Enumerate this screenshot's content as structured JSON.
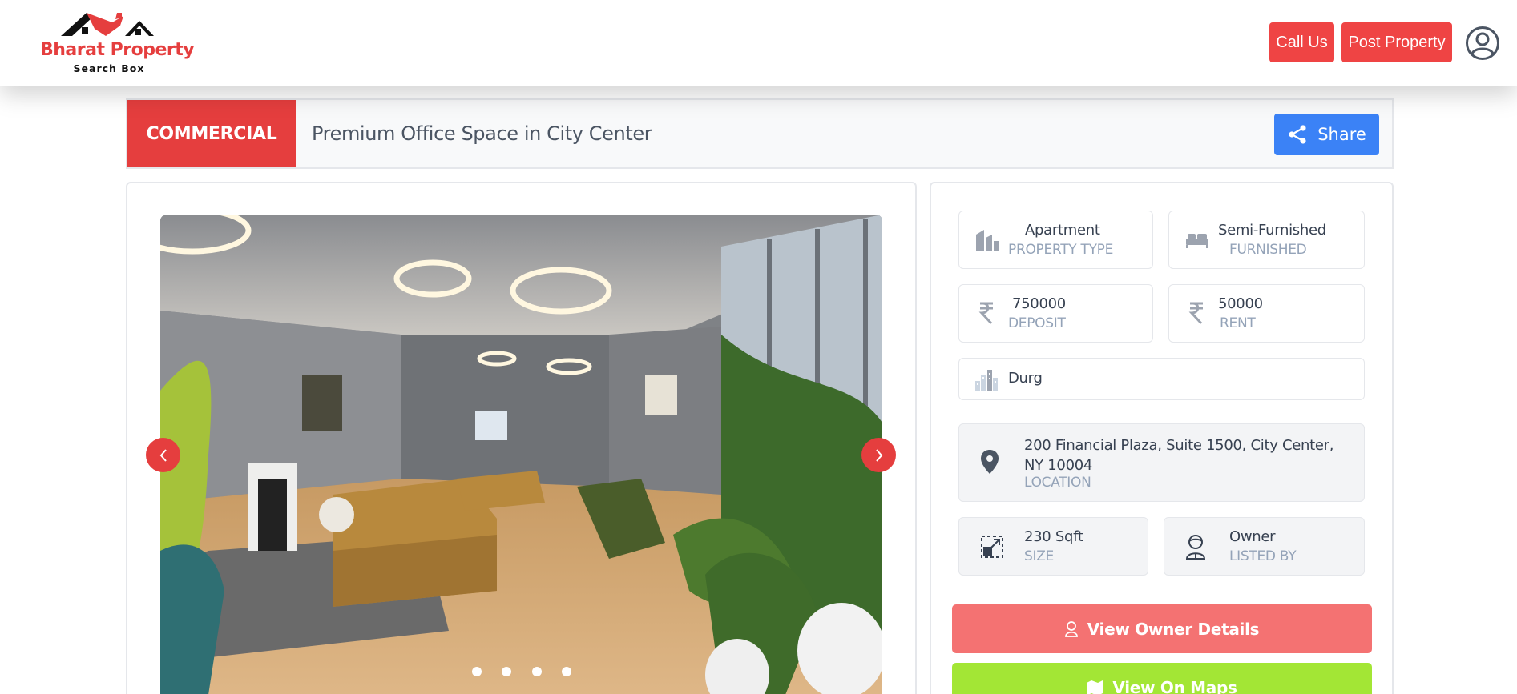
{
  "brand": {
    "name": "Bharat Property",
    "tagline": "Search Box"
  },
  "header": {
    "call_label": "Call Us",
    "post_label": "Post Property",
    "profile_icon": "user-circle-icon"
  },
  "listing": {
    "category": "COMMERCIAL",
    "title": "Premium Office Space in City Center",
    "share_label": "Share"
  },
  "gallery": {
    "slide_count": 4,
    "active_slide": 1
  },
  "details": {
    "property_type": {
      "value": "Apartment",
      "label": "PROPERTY TYPE",
      "icon": "building-icon"
    },
    "furnished": {
      "value": "Semi-Furnished",
      "label": "FURNISHED",
      "icon": "bed-icon"
    },
    "deposit": {
      "value": "750000",
      "label": "DEPOSIT",
      "icon": "rupee-icon"
    },
    "rent": {
      "value": "50000",
      "label": "RENT",
      "icon": "rupee-icon"
    },
    "city": {
      "value": "Durg",
      "icon": "city-icon"
    },
    "location": {
      "value": "200 Financial Plaza, Suite 1500, City Center, NY 10004",
      "label": "LOCATION",
      "icon": "map-pin-icon"
    },
    "size": {
      "value": "230 Sqft",
      "label": "SIZE",
      "icon": "resize-icon"
    },
    "listed_by": {
      "value": "Owner",
      "label": "LISTED BY",
      "icon": "person-icon"
    }
  },
  "actions": {
    "owner_label": "View Owner Details",
    "maps_label": "View On Maps"
  },
  "colors": {
    "brand_red": "#e53e3e",
    "share_blue": "#3b82f6",
    "maps_green": "#a3e635",
    "owner_pink": "#f47272"
  }
}
